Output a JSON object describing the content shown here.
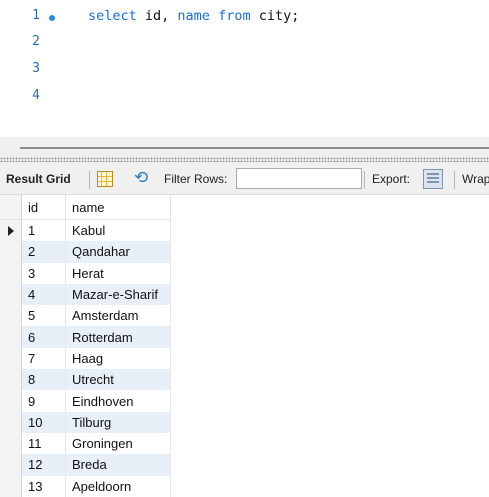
{
  "editor": {
    "lines": [
      {
        "number": "1",
        "tokens": [
          {
            "text": "select",
            "kw": true
          },
          {
            "text": " id, ",
            "kw": false
          },
          {
            "text": "name",
            "kw": true
          },
          {
            "text": " ",
            "kw": false
          },
          {
            "text": "from",
            "kw": true
          },
          {
            "text": " city;",
            "kw": false
          }
        ]
      },
      {
        "number": "2",
        "tokens": []
      },
      {
        "number": "3",
        "tokens": []
      },
      {
        "number": "4",
        "tokens": []
      }
    ]
  },
  "toolbar": {
    "result_grid_label": "Result Grid",
    "filter_label": "Filter Rows:",
    "filter_value": "",
    "export_label": "Export:",
    "wrap_label": "Wrap"
  },
  "grid": {
    "columns": [
      "id",
      "name"
    ],
    "rows": [
      [
        "1",
        "Kabul"
      ],
      [
        "2",
        "Qandahar"
      ],
      [
        "3",
        "Herat"
      ],
      [
        "4",
        "Mazar-e-Sharif"
      ],
      [
        "5",
        "Amsterdam"
      ],
      [
        "6",
        "Rotterdam"
      ],
      [
        "7",
        "Haag"
      ],
      [
        "8",
        "Utrecht"
      ],
      [
        "9",
        "Eindhoven"
      ],
      [
        "10",
        "Tilburg"
      ],
      [
        "11",
        "Groningen"
      ],
      [
        "12",
        "Breda"
      ],
      [
        "13",
        "Apeldoorn"
      ]
    ],
    "current_row": 0
  },
  "colors": {
    "keyword": "#1a6fd6",
    "line_number": "#2a6db3",
    "alt_row": "#e8eff9"
  }
}
